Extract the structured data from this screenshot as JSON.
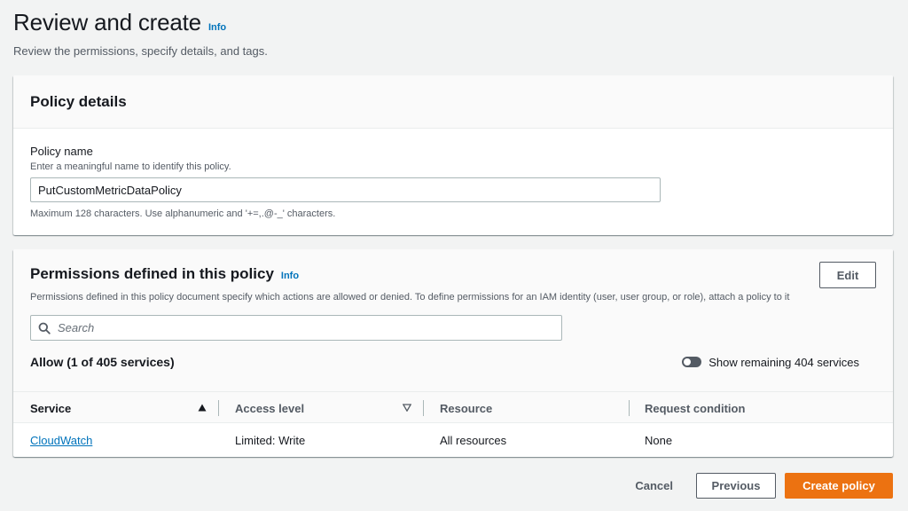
{
  "header": {
    "title": "Review and create",
    "info_label": "Info",
    "subtitle": "Review the permissions, specify details, and tags."
  },
  "policy_details": {
    "heading": "Policy details",
    "name_label": "Policy name",
    "name_description": "Enter a meaningful name to identify this policy.",
    "name_value": "PutCustomMetricDataPolicy",
    "name_constraint": "Maximum 128 characters. Use alphanumeric and '+=,.@-_' characters."
  },
  "permissions": {
    "heading": "Permissions defined in this policy",
    "info_label": "Info",
    "edit_label": "Edit",
    "description": "Permissions defined in this policy document specify which actions are allowed or denied. To define permissions for an IAM identity (user, user group, or role), attach a policy to it",
    "search_placeholder": "Search",
    "allow_title": "Allow (1 of 405 services)",
    "toggle_label": "Show remaining 404 services",
    "toggle_on": false,
    "columns": [
      "Service",
      "Access level",
      "Resource",
      "Request condition"
    ],
    "rows": [
      {
        "service": "CloudWatch",
        "access_level": "Limited: Write",
        "resource": "All resources",
        "request_condition": "None"
      }
    ]
  },
  "footer": {
    "cancel_label": "Cancel",
    "previous_label": "Previous",
    "create_label": "Create policy"
  },
  "colors": {
    "primary_button": "#ec7211",
    "link": "#0073bb",
    "background": "#f2f3f3"
  },
  "icons": {
    "search": "search-icon",
    "sort_ascending": "sort-ascending-icon",
    "sort_descending": "sort-descending-icon"
  }
}
